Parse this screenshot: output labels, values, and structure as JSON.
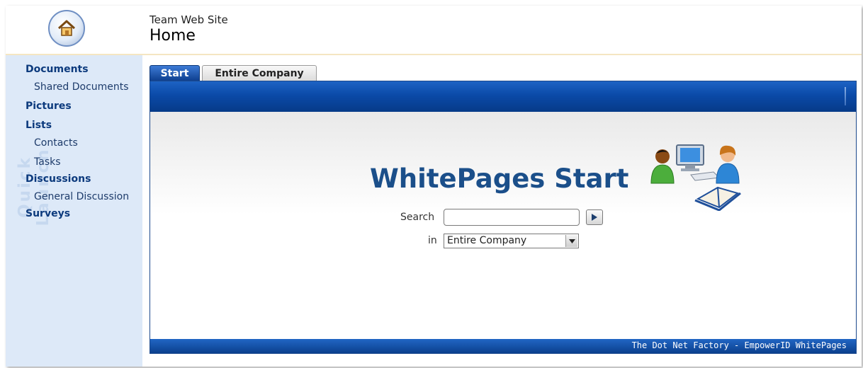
{
  "header": {
    "site_name": "Team Web Site",
    "page_title": "Home",
    "logo_icon": "home-icon"
  },
  "quicklaunch": {
    "watermark": "Quick Launch",
    "items": [
      {
        "label": "Documents",
        "type": "heading"
      },
      {
        "label": "Shared Documents",
        "type": "sub"
      },
      {
        "label": "Pictures",
        "type": "heading"
      },
      {
        "label": "Lists",
        "type": "heading"
      },
      {
        "label": "Contacts",
        "type": "sub"
      },
      {
        "label": "Tasks",
        "type": "sub"
      },
      {
        "label": "Discussions",
        "type": "heading"
      },
      {
        "label": "General Discussion",
        "type": "sub"
      },
      {
        "label": "Surveys",
        "type": "heading"
      }
    ]
  },
  "tabs": [
    {
      "label": "Start",
      "active": true
    },
    {
      "label": "Entire Company",
      "active": false
    }
  ],
  "main": {
    "title": "WhitePages Start",
    "search_label": "Search",
    "search_value": "",
    "go_icon": "play-arrow-icon",
    "in_label": "in",
    "scope_selected": "Entire Company",
    "footer": "The Dot Net Factory - EmpowerID WhitePages"
  },
  "colors": {
    "accent_blue": "#0b4aa8",
    "title_blue": "#1b4f8a",
    "nav_bg": "#dde9f8",
    "nav_link": "#0c3a7d"
  }
}
